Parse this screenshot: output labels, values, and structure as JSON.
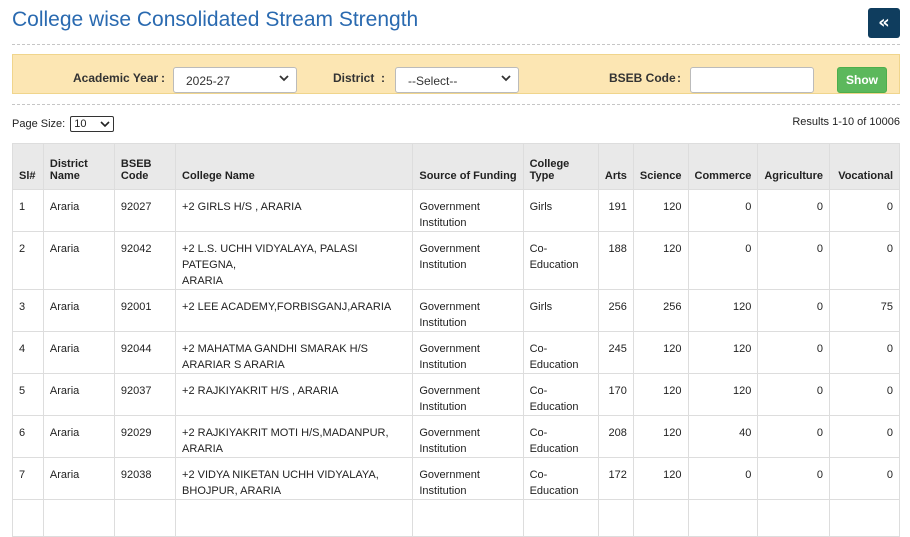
{
  "page": {
    "title": "College wise Consolidated Stream Strength",
    "back_icon": "«"
  },
  "filters": {
    "academic_year_label": "Academic Year",
    "academic_year_value": "2025-27",
    "district_label": "District",
    "district_value": "--Select--",
    "bseb_label": "BSEB Code",
    "bseb_value": "",
    "colon": ":",
    "show_label": "Show"
  },
  "paging": {
    "page_size_label": "Page Size:",
    "page_size_value": "10",
    "results_text": "Results 1-10 of 10006"
  },
  "table": {
    "headers": {
      "sl": "Sl#",
      "district_line1": "District",
      "district_line2": "Name",
      "bseb_line1": "BSEB",
      "bseb_line2": "Code",
      "college": "College Name",
      "funding": "Source of Funding",
      "type_line1": "College",
      "type_line2": "Type",
      "arts": "Arts",
      "science": "Science",
      "commerce": "Commerce",
      "agriculture": "Agriculture",
      "vocational": "Vocational"
    },
    "rows": [
      {
        "sl": "1",
        "district": "Araria",
        "code": "92027",
        "college_l1": "+2 GIRLS H/S , ARARIA",
        "college_l2": "",
        "funding_l1": "Government",
        "funding_l2": "Institution",
        "type_l1": "Girls",
        "type_l2": "",
        "arts": "191",
        "science": "120",
        "commerce": "0",
        "agriculture": "0",
        "vocational": "0"
      },
      {
        "sl": "2",
        "district": "Araria",
        "code": "92042",
        "college_l1": "+2 L.S. UCHH VIDYALAYA, PALASI PATEGNA,",
        "college_l2": "ARARIA",
        "funding_l1": "Government",
        "funding_l2": "Institution",
        "type_l1": "Co-",
        "type_l2": "Education",
        "arts": "188",
        "science": "120",
        "commerce": "0",
        "agriculture": "0",
        "vocational": "0"
      },
      {
        "sl": "3",
        "district": "Araria",
        "code": "92001",
        "college_l1": "+2 LEE ACADEMY,FORBISGANJ,ARARIA",
        "college_l2": "",
        "funding_l1": "Government",
        "funding_l2": "Institution",
        "type_l1": "Girls",
        "type_l2": "",
        "arts": "256",
        "science": "256",
        "commerce": "120",
        "agriculture": "0",
        "vocational": "75"
      },
      {
        "sl": "4",
        "district": "Araria",
        "code": "92044",
        "college_l1": "+2 MAHATMA GANDHI SMARAK H/S",
        "college_l2": "ARARIAR S ARARIA",
        "funding_l1": "Government",
        "funding_l2": "Institution",
        "type_l1": "Co-",
        "type_l2": "Education",
        "arts": "245",
        "science": "120",
        "commerce": "120",
        "agriculture": "0",
        "vocational": "0"
      },
      {
        "sl": "5",
        "district": "Araria",
        "code": "92037",
        "college_l1": "+2 RAJKIYAKRIT H/S , ARARIA",
        "college_l2": "",
        "funding_l1": "Government",
        "funding_l2": "Institution",
        "type_l1": "Co-",
        "type_l2": "Education",
        "arts": "170",
        "science": "120",
        "commerce": "120",
        "agriculture": "0",
        "vocational": "0"
      },
      {
        "sl": "6",
        "district": "Araria",
        "code": "92029",
        "college_l1": "+2 RAJKIYAKRIT MOTI H/S,MADANPUR,",
        "college_l2": "ARARIA",
        "funding_l1": "Government",
        "funding_l2": "Institution",
        "type_l1": "Co-",
        "type_l2": "Education",
        "arts": "208",
        "science": "120",
        "commerce": "40",
        "agriculture": "0",
        "vocational": "0"
      },
      {
        "sl": "7",
        "district": "Araria",
        "code": "92038",
        "college_l1": "+2 VIDYA NIKETAN UCHH VIDYALAYA,",
        "college_l2": "BHOJPUR, ARARIA",
        "funding_l1": "Government",
        "funding_l2": "Institution",
        "type_l1": "Co-",
        "type_l2": "Education",
        "arts": "172",
        "science": "120",
        "commerce": "0",
        "agriculture": "0",
        "vocational": "0"
      },
      {
        "sl": "",
        "district": "",
        "code": "",
        "college_l1": "",
        "college_l2": "",
        "funding_l1": "",
        "funding_l2": "",
        "type_l1": "",
        "type_l2": "",
        "arts": "",
        "science": "",
        "commerce": "",
        "agriculture": "",
        "vocational": ""
      }
    ]
  },
  "colors": {
    "title": "#2a6ab0",
    "back_button": "#0f3d5e",
    "filter_bar": "#fce6b3",
    "show_button": "#5cb85c",
    "table_header": "#e9e9e9"
  }
}
